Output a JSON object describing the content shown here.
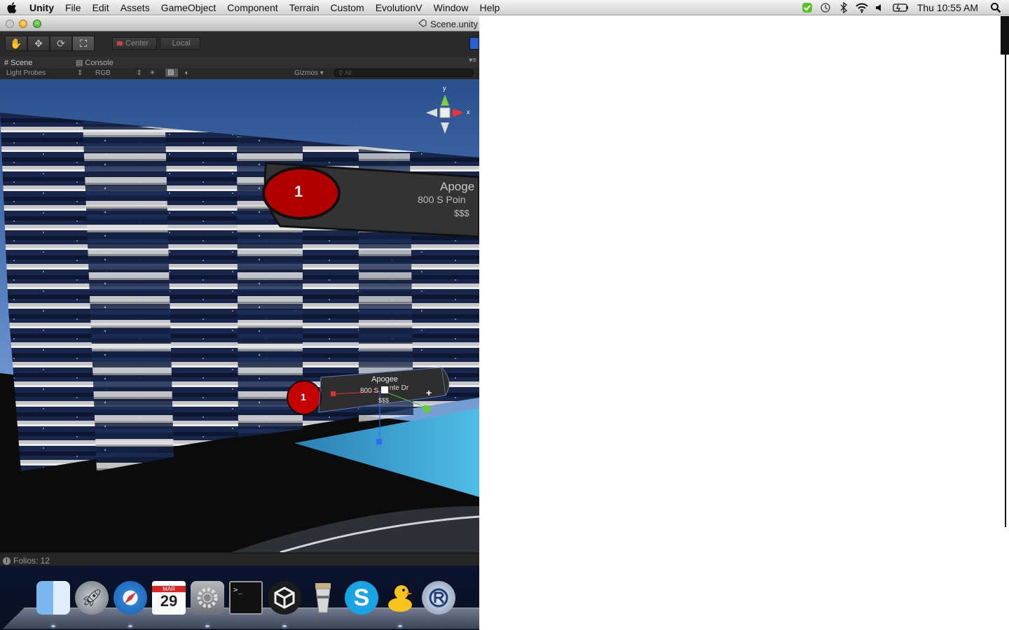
{
  "menubar": {
    "app_name": "Unity",
    "items": [
      "File",
      "Edit",
      "Assets",
      "GameObject",
      "Component",
      "Terrain",
      "Custom",
      "EvolutionV",
      "Window",
      "Help"
    ],
    "status_icons": [
      "growl-icon",
      "time-machine-icon",
      "bluetooth-icon",
      "wifi-icon",
      "volume-icon",
      "battery-icon"
    ],
    "clock": "Thu 10:55 AM"
  },
  "window": {
    "title": "Scene.unity"
  },
  "toolbar": {
    "tools": [
      "hand-icon",
      "move-icon",
      "rotate-icon",
      "scale-icon"
    ],
    "pivot_center": "Center",
    "pivot_local": "Local"
  },
  "tabs": {
    "scene": "Scene",
    "console": "Console"
  },
  "scene_controls": {
    "render_mode": "Light Probes",
    "color_mode": "RGB",
    "gizmos": "Gizmos",
    "search_placeholder": "All"
  },
  "scene": {
    "axis_y": "y",
    "axis_x": "x",
    "panel_large": {
      "badge": "1",
      "name": "Apoge",
      "address": "800 S Poin",
      "price": "$$$"
    },
    "panel_small": {
      "badge": "1",
      "name": "Apogee",
      "address_left": "800 S",
      "address_right": "nte Dr",
      "price": "$$$"
    }
  },
  "statusbar": {
    "text": "Folios: 12"
  },
  "dock": {
    "calendar_month": "MAR",
    "calendar_day": "29",
    "apps": [
      "finder-icon",
      "launchpad-icon",
      "safari-icon",
      "calendar-icon",
      "system-preferences-icon",
      "terminal-icon",
      "unity-icon",
      "archive-icon",
      "skype-icon",
      "cyberduck-icon",
      "remote-desktop-icon"
    ]
  },
  "colors": {
    "menubar": "#dcdcdc",
    "editor_bg": "#2a2a2a",
    "badge_red": "#c40000",
    "sky": "#3a5f9a",
    "water": "#3aa0cc"
  }
}
